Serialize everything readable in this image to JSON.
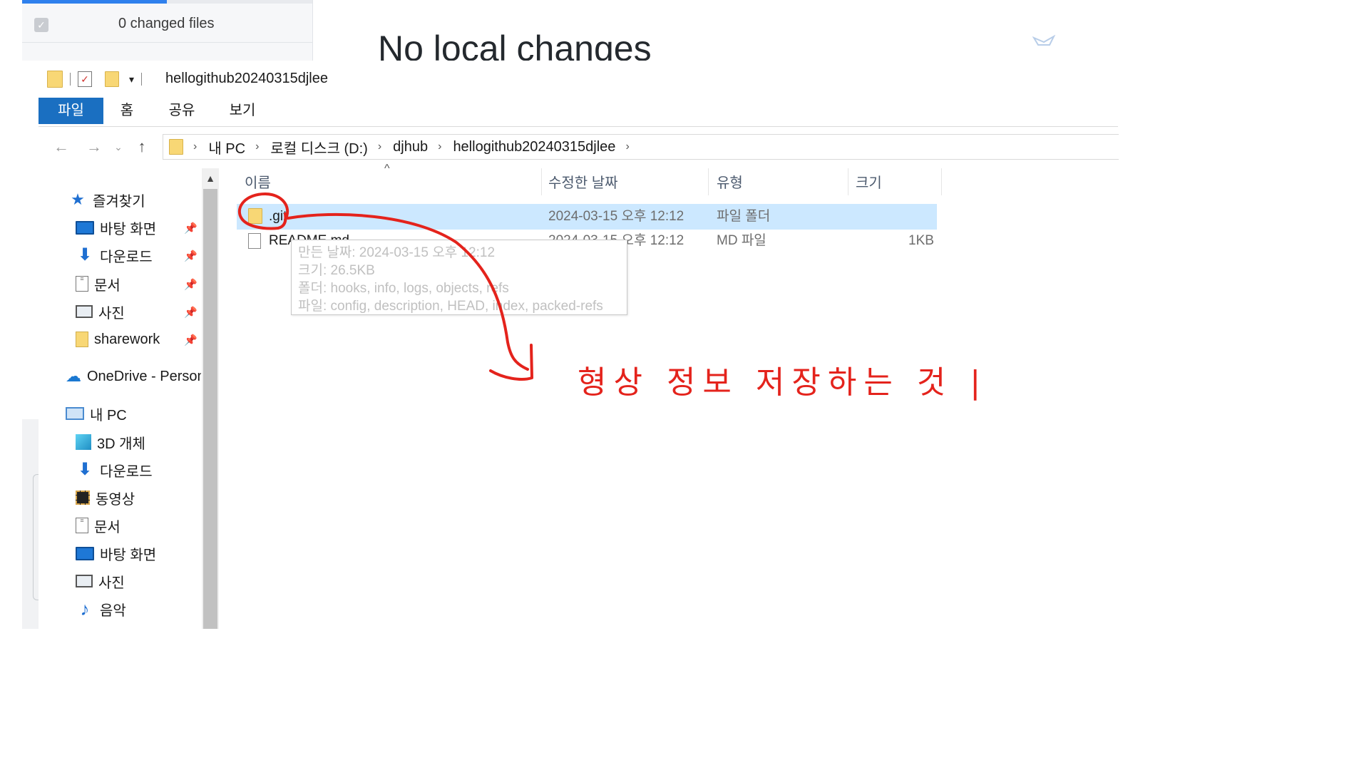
{
  "github_desktop": {
    "changed_files_label": "0 changed files",
    "heading": "No local changes"
  },
  "explorer": {
    "window_title": "hellogithub20240315djlee",
    "ribbon_tabs": [
      "파일",
      "홈",
      "공유",
      "보기"
    ],
    "breadcrumb": [
      "내 PC",
      "로컬 디스크 (D:)",
      "djhub",
      "hellogithub20240315djlee"
    ],
    "nav_pane": {
      "quick_access": "즐겨찾기",
      "quick_items": [
        "바탕 화면",
        "다운로드",
        "문서",
        "사진",
        "sharework"
      ],
      "onedrive": "OneDrive - Personal",
      "this_pc": "내 PC",
      "pc_items": [
        "3D 개체",
        "다운로드",
        "동영상",
        "문서",
        "바탕 화면",
        "사진",
        "음악"
      ]
    },
    "columns": [
      "이름",
      "수정한 날짜",
      "유형",
      "크기"
    ],
    "files": [
      {
        "name": ".git",
        "modified": "2024-03-15 오후 12:12",
        "type": "파일 폴더",
        "size": ""
      },
      {
        "name": "README.md",
        "modified": "2024-03-15 오후 12:12",
        "type": "MD 파일",
        "size": "1KB"
      }
    ],
    "tooltip": [
      "만든 날짜: 2024-03-15 오후 12:12",
      "크기: 26.5KB",
      "폴더: hooks, info, logs, objects, refs",
      "파일: config, description, HEAD, index, packed-refs"
    ]
  },
  "annotation": {
    "text": "형상 정보 저장하는 것 |",
    "color": "#e4231c"
  },
  "colors": {
    "accent": "#1a6fc1",
    "selection": "#cce8ff"
  }
}
